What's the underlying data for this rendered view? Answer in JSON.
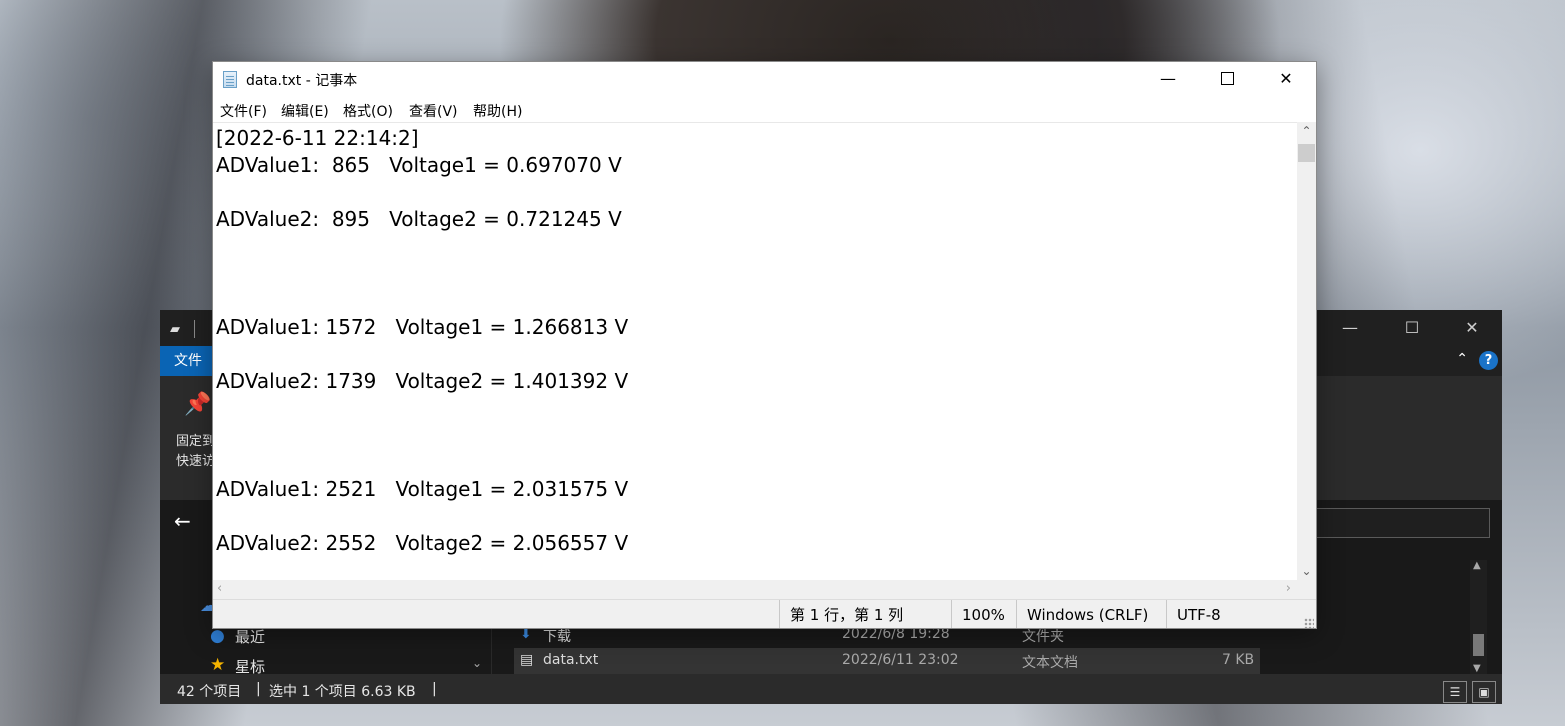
{
  "notepad": {
    "title": "data.txt - 记事本",
    "menu": [
      "文件(F)",
      "编辑(E)",
      "格式(O)",
      "查看(V)",
      "帮助(H)"
    ],
    "lines": [
      "[2022-6-11 22:14:2]",
      "ADValue1:  865   Voltage1 = 0.697070 V",
      "ADValue2:  895   Voltage2 = 0.721245 V",
      "ADValue1: 1572   Voltage1 = 1.266813 V",
      "ADValue2: 1739   Voltage2 = 1.401392 V",
      "ADValue1: 2521   Voltage1 = 2.031575 V",
      "ADValue2: 2552   Voltage2 = 2.056557 V"
    ],
    "status": {
      "position": "第 1 行，第 1 列",
      "zoom": "100%",
      "line_ending": "Windows (CRLF)",
      "encoding": "UTF-8"
    }
  },
  "explorer": {
    "file_tab": "文件",
    "pin_label_1": "固定到",
    "pin_label_2": "快速访",
    "nav_items": [
      {
        "label": "最近",
        "icon": "clock-icon"
      },
      {
        "label": "星标",
        "icon": "star-icon"
      }
    ],
    "files": [
      {
        "name": "下载",
        "date": "2022/6/8 19:28",
        "type": "文件夹",
        "size": "",
        "icon": "download-folder-icon"
      },
      {
        "name": "data.txt",
        "date": "2022/6/11 23:02",
        "type": "文本文档",
        "size": "7 KB",
        "icon": "text-file-icon"
      }
    ],
    "status": {
      "count": "42 个项目",
      "selected": "选中 1 个项目  6.63 KB"
    }
  },
  "colors": {
    "explorer_bg": "#191919",
    "explorer_file_tab": "#0a64b4",
    "notepad_bg": "#ffffff",
    "status_bar": "#f0f0f0"
  }
}
